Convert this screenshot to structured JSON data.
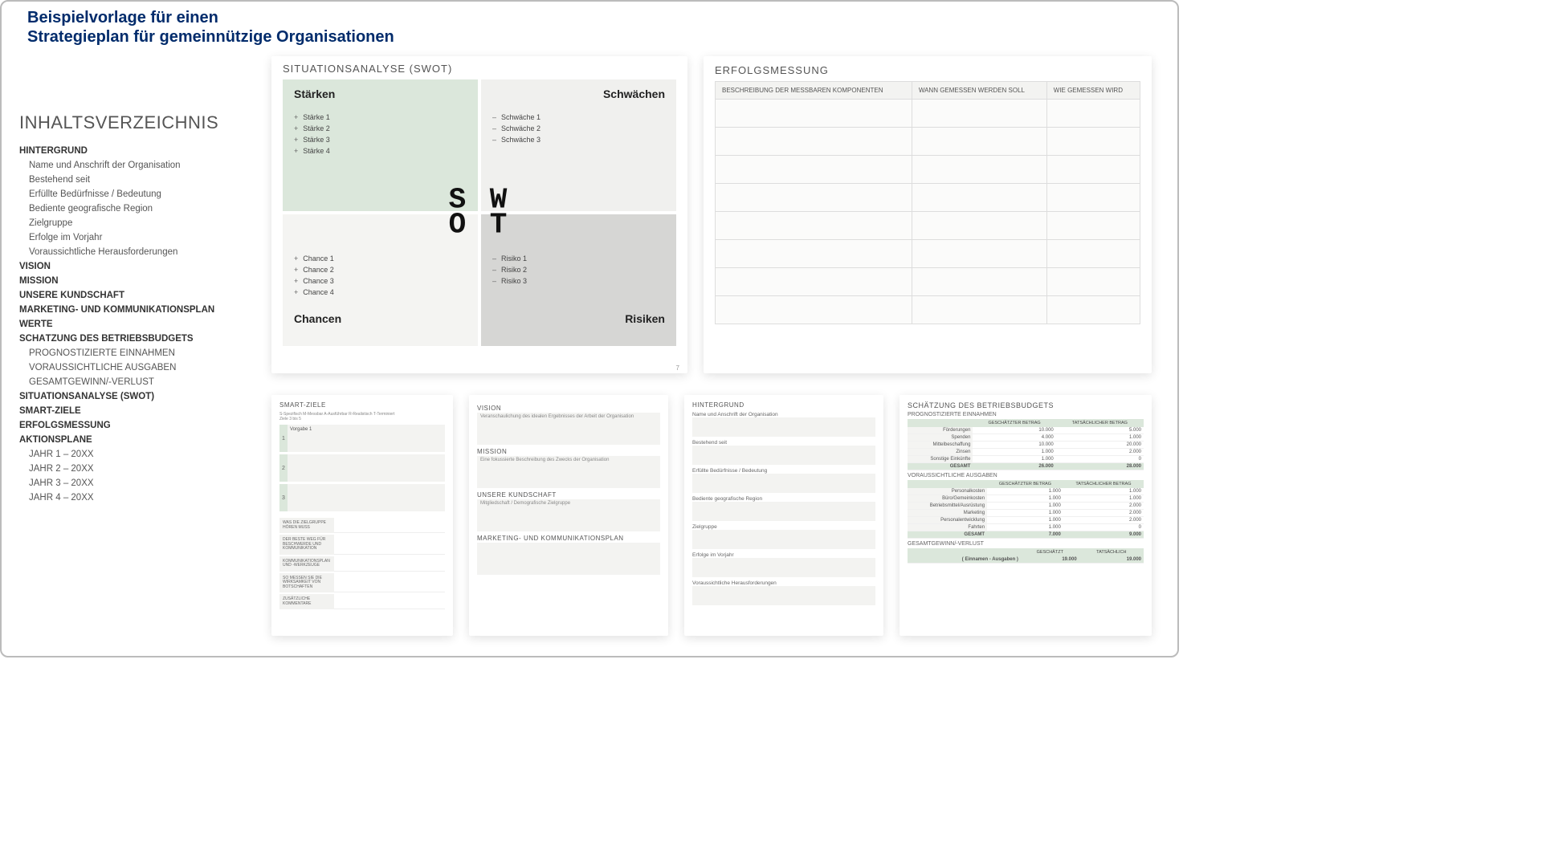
{
  "header": {
    "line1": "Beispielvorlage für einen",
    "line2": "Strategieplan für gemeinnützige Organisationen"
  },
  "toc": {
    "title": "INHALTSVERZEICHNIS",
    "items": [
      {
        "lvl": 1,
        "t": "HINTERGRUND"
      },
      {
        "lvl": 2,
        "t": "Name und Anschrift der Organisation"
      },
      {
        "lvl": 2,
        "t": "Bestehend seit"
      },
      {
        "lvl": 2,
        "t": "Erfüllte Bedürfnisse / Bedeutung"
      },
      {
        "lvl": 2,
        "t": "Bediente geografische Region"
      },
      {
        "lvl": 2,
        "t": "Zielgruppe"
      },
      {
        "lvl": 2,
        "t": "Erfolge im Vorjahr"
      },
      {
        "lvl": 2,
        "t": "Voraussichtliche Herausforderungen"
      },
      {
        "lvl": 1,
        "t": "VISION"
      },
      {
        "lvl": 1,
        "t": "MISSION"
      },
      {
        "lvl": 1,
        "t": "UNSERE KUNDSCHAFT"
      },
      {
        "lvl": 1,
        "t": "MARKETING- UND KOMMUNIKATIONSPLAN"
      },
      {
        "lvl": 1,
        "t": "WERTE"
      },
      {
        "lvl": 1,
        "t": "SCHÄTZUNG DES BETRIEBSBUDGETS"
      },
      {
        "lvl": 2,
        "t": "PROGNOSTIZIERTE EINNAHMEN"
      },
      {
        "lvl": 2,
        "t": "VORAUSSICHTLICHE AUSGABEN"
      },
      {
        "lvl": 2,
        "t": "GESAMTGEWINN/-VERLUST"
      },
      {
        "lvl": 1,
        "t": "SITUATIONSANALYSE (SWOT)"
      },
      {
        "lvl": 1,
        "t": "SMART-ZIELE"
      },
      {
        "lvl": 1,
        "t": "ERFOLGSMESSUNG"
      },
      {
        "lvl": 1,
        "t": "AKTIONSPLÄNE"
      },
      {
        "lvl": 2,
        "t": "JAHR 1 – 20XX"
      },
      {
        "lvl": 2,
        "t": "JAHR 2 – 20XX"
      },
      {
        "lvl": 2,
        "t": "JAHR 3 – 20XX"
      },
      {
        "lvl": 2,
        "t": "JAHR 4 – 20XX"
      }
    ]
  },
  "swot": {
    "title": "SITUATIONSANALYSE (SWOT)",
    "s": {
      "h": "Stärken",
      "items": [
        "Stärke 1",
        "Stärke 2",
        "Stärke 3",
        "Stärke 4"
      ]
    },
    "w": {
      "h": "Schwächen",
      "items": [
        "Schwäche 1",
        "Schwäche 2",
        "Schwäche 3"
      ]
    },
    "o": {
      "h": "Chancen",
      "items": [
        "Chance 1",
        "Chance 2",
        "Chance 3",
        "Chance 4"
      ]
    },
    "t": {
      "h": "Risiken",
      "items": [
        "Risiko 1",
        "Risiko 2",
        "Risiko 3"
      ]
    },
    "center": {
      "top": "S W",
      "bot": "O T"
    },
    "pnum": "7"
  },
  "erf": {
    "title": "ERFOLGSMESSUNG",
    "cols": [
      "BESCHREIBUNG DER MESSBAREN KOMPONENTEN",
      "WANN GEMESSEN WERDEN SOLL",
      "WIE GEMESSEN WIRD"
    ],
    "rows": 8
  },
  "smart": {
    "title": "SMART-ZIELE",
    "sub": "S-Spezifisch   M-Messbar   A-Ausführbar   R-Realistisch   T-Terminiert\nZiele 3 bis 5",
    "placeholder": "Vorgabe 1",
    "side": [
      "WAS DIE ZIELGRUPPE HÖREN MUSS",
      "DER BESTE WEG FÜR BESCHWERDE UND KOMMUNIKATION",
      "KOMMUNIKATIONSPLAN UND -WERKZEUGE",
      "SO MESSEN SIE DIE WIRKSAMKEIT VON BOTSCHAFTEN",
      "ZUSÄTZLICHE KOMMENTARE"
    ]
  },
  "visionCard": {
    "sections": [
      {
        "h": "VISION",
        "f": "Veranschaulichung des idealen Ergebnisses der Arbeit der Organisation"
      },
      {
        "h": "MISSION",
        "f": "Eine fokussierte Beschreibung des Zwecks der Organisation"
      },
      {
        "h": "UNSERE KUNDSCHAFT",
        "f": "Mitgliedschaft / Demografische Zielgruppe"
      },
      {
        "h": "MARKETING- UND KOMMUNIKATIONSPLAN",
        "f": ""
      }
    ]
  },
  "hinter": {
    "title": "HINTERGRUND",
    "fields": [
      "Name und Anschrift der Organisation",
      "Bestehend seit",
      "Erfüllte Bedürfnisse / Bedeutung",
      "Bediente geografische Region",
      "Zielgruppe",
      "Erfolge im Vorjahr",
      "Voraussichtliche Herausforderungen"
    ]
  },
  "budget": {
    "title": "SCHÄTZUNG DES BETRIEBSBUDGETS",
    "income": {
      "sub": "PROGNOSTIZIERTE EINNAHMEN",
      "cols": [
        "",
        "GESCHÄTZTER BETRAG",
        "TATSÄCHLICHER BETRAG"
      ],
      "rows": [
        [
          "Förderungen",
          "10.000",
          "5.000"
        ],
        [
          "Spenden",
          "4.000",
          "1.000"
        ],
        [
          "Mittelbeschaffung",
          "10.000",
          "20.000"
        ],
        [
          "Zinsen",
          "1.000",
          "2.000"
        ],
        [
          "Sonstige Einkünfte",
          "1.000",
          "0"
        ]
      ],
      "total": [
        "GESAMT",
        "26.000",
        "28.000"
      ]
    },
    "expense": {
      "sub": "VORAUSSICHTLICHE AUSGABEN",
      "cols": [
        "",
        "GESCHÄTZTER BETRAG",
        "TATSÄCHLICHER BETRAG"
      ],
      "rows": [
        [
          "Personalkosten",
          "1.000",
          "1.000"
        ],
        [
          "Büro/Gemeinkosten",
          "1.000",
          "1.000"
        ],
        [
          "Betriebsmittel/Ausrüstung",
          "1.000",
          "2.000"
        ],
        [
          "Marketing",
          "1.000",
          "2.000"
        ],
        [
          "Personalentwicklung",
          "1.000",
          "2.000"
        ],
        [
          "Fahrten",
          "1.000",
          "0"
        ]
      ],
      "total": [
        "GESAMT",
        "7.000",
        "9.000"
      ]
    },
    "profit": {
      "sub": "GESAMTGEWINN/-VERLUST",
      "cols": [
        "",
        "GESCHÄTZT",
        "TATSÄCHLICH"
      ],
      "row": [
        "( Einnamen - Ausgaben )",
        "19.000",
        "19.000"
      ]
    }
  }
}
